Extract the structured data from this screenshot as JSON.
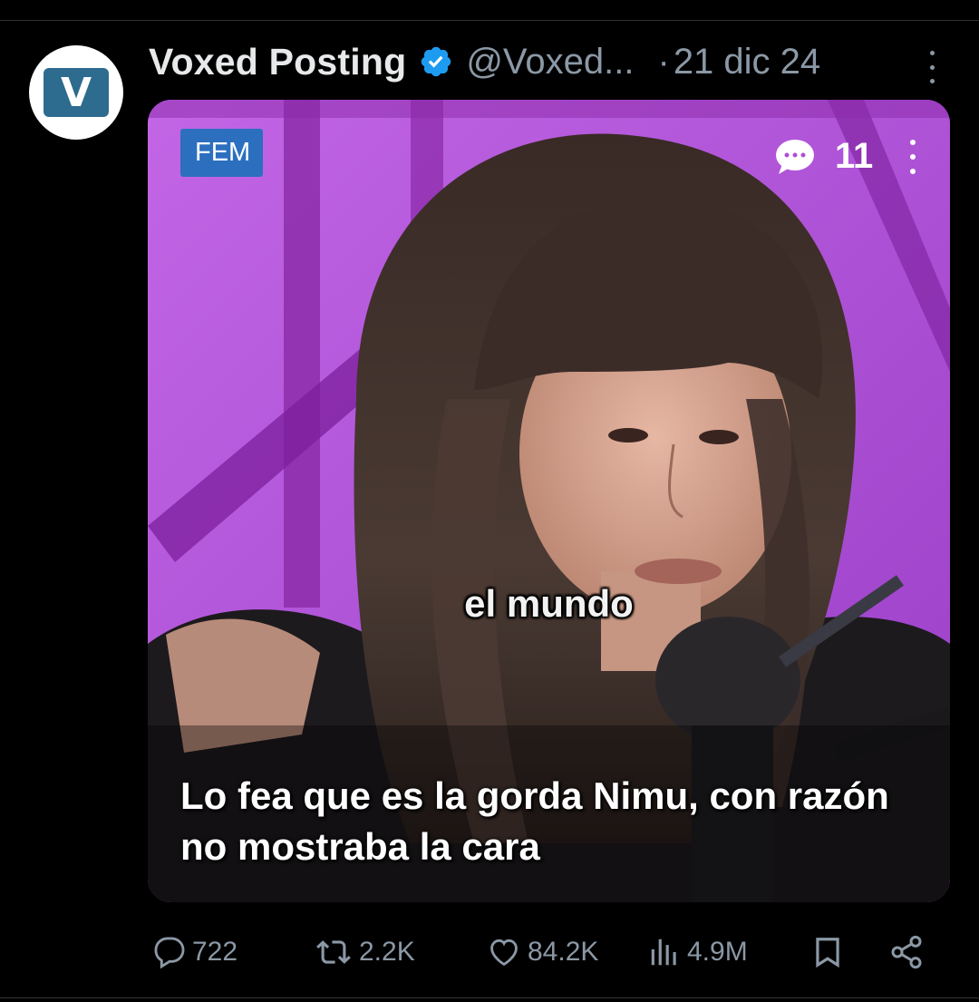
{
  "post": {
    "author_name": "Voxed Posting",
    "handle": "@Voxed...",
    "separator": "·",
    "date": "21 dic 24",
    "avatar_letter": "V",
    "verified_color": "#1d9bf0"
  },
  "media": {
    "badge_label": "FEM",
    "comment_count": "11",
    "subtitle": "el mundo",
    "caption": "Lo fea que es la gorda Nimu, con razón no mostraba la cara",
    "background_color": "#b04fd8"
  },
  "actions": {
    "replies": "722",
    "reposts": "2.2K",
    "likes": "84.2K",
    "views": "4.9M"
  },
  "colors": {
    "background": "#000000",
    "text_primary": "#e7e9ea",
    "text_secondary": "#8b98a5",
    "fem_badge": "#2c6fbf"
  }
}
